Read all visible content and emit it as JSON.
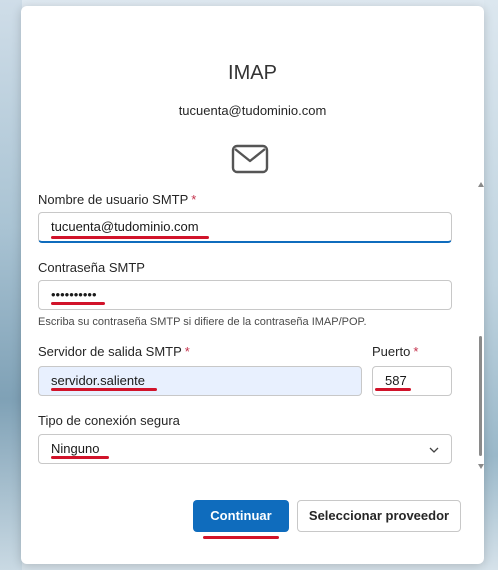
{
  "dialog": {
    "title": "IMAP",
    "email": "tucuenta@tudominio.com"
  },
  "icons": {
    "mail": "mail-envelope-icon",
    "dropdown": "chevron-down-icon"
  },
  "form": {
    "smtp_user": {
      "label": "Nombre de usuario SMTP",
      "required_mark": "*",
      "value": "tucuenta@tudominio.com"
    },
    "smtp_password": {
      "label": "Contraseña SMTP",
      "value": "••••••••••",
      "hint": "Escriba su contraseña SMTP si difiere de la contraseña IMAP/POP."
    },
    "smtp_server": {
      "label": "Servidor de salida SMTP",
      "required_mark": "*",
      "value": "servidor.saliente"
    },
    "port": {
      "label": "Puerto",
      "required_mark": "*",
      "value": "587"
    },
    "connection_type": {
      "label": "Tipo de conexión segura",
      "value": "Ninguno"
    }
  },
  "buttons": {
    "continue": "Continuar",
    "select_provider": "Seleccionar proveedor"
  },
  "colors": {
    "accent": "#0f6cbd",
    "required": "#c4314b",
    "annotation": "#d1132a"
  }
}
